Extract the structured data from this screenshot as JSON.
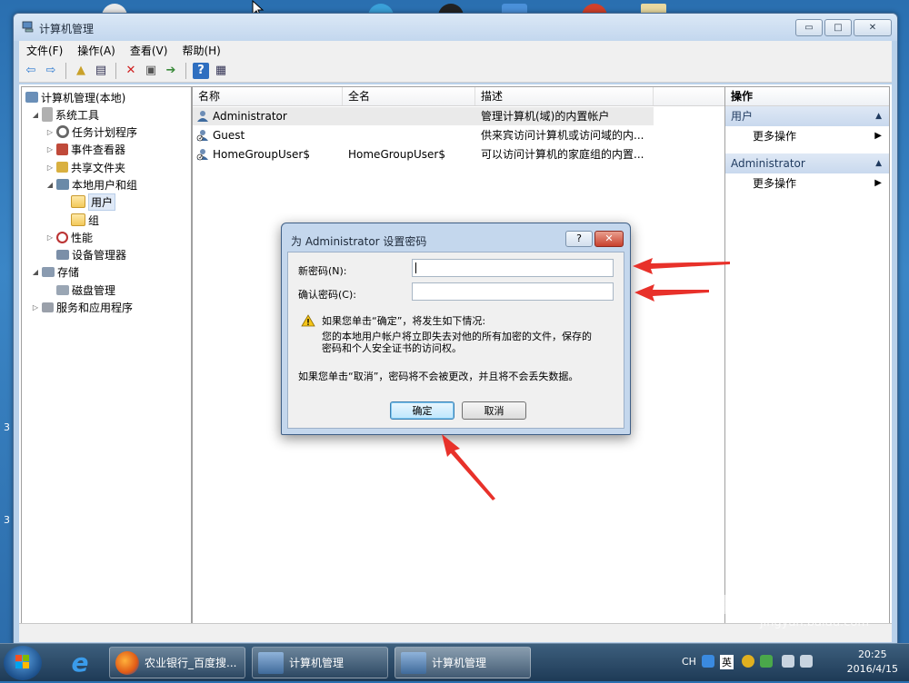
{
  "window": {
    "title": "计算机管理",
    "buttons": {
      "minimize": "▭",
      "maximize": "□",
      "close": "✕"
    }
  },
  "menu": [
    "文件(F)",
    "操作(A)",
    "查看(V)",
    "帮助(H)"
  ],
  "tree": {
    "root": "计算机管理(本地)",
    "system_tools": "系统工具",
    "task_scheduler": "任务计划程序",
    "event_viewer": "事件查看器",
    "shared_folders": "共享文件夹",
    "local_users_groups": "本地用户和组",
    "users": "用户",
    "groups": "组",
    "performance": "性能",
    "device_manager": "设备管理器",
    "storage": "存储",
    "disk_management": "磁盘管理",
    "services_apps": "服务和应用程序"
  },
  "list": {
    "columns": [
      "名称",
      "全名",
      "描述"
    ],
    "rows": [
      {
        "name": "Administrator",
        "fullname": "",
        "description": "管理计算机(域)的内置帐户"
      },
      {
        "name": "Guest",
        "fullname": "",
        "description": "供来宾访问计算机或访问域的内..."
      },
      {
        "name": "HomeGroupUser$",
        "fullname": "HomeGroupUser$",
        "description": "可以访问计算机的家庭组的内置..."
      }
    ]
  },
  "actions": {
    "header": "操作",
    "groups": [
      {
        "title": "用户",
        "item": "更多操作"
      },
      {
        "title": "Administrator",
        "item": "更多操作"
      }
    ]
  },
  "dialog": {
    "title": "为 Administrator 设置密码",
    "new_password_label": "新密码(N):",
    "confirm_password_label": "确认密码(C):",
    "new_password_value": "",
    "confirm_password_value": "",
    "warning_line1": "如果您单击“确定”，将发生如下情况:",
    "warning_line2": "您的本地用户帐户将立即失去对他的所有加密的文件，保存的",
    "warning_line3": "密码和个人安全证书的访问权。",
    "cancel_note": "如果您单击“取消”，密码将不会被更改，并且将不会丢失数据。",
    "ok_label": "确定",
    "cancel_label": "取消",
    "help_label": "?",
    "close_label": "✕"
  },
  "taskbar": {
    "tasks": [
      "农业银行_百度搜...",
      "计算机管理",
      "计算机管理"
    ],
    "lang": "CH",
    "ime": "英",
    "time": "20:25",
    "date": "2016/4/15"
  },
  "watermark": {
    "brand": "Baidu经验",
    "url": "jingyan.baidu.com"
  },
  "desktop_side": [
    "3",
    "3"
  ],
  "colors": {
    "accent_arrow": "#e8312a",
    "title_bg": "#c3d7ee"
  }
}
